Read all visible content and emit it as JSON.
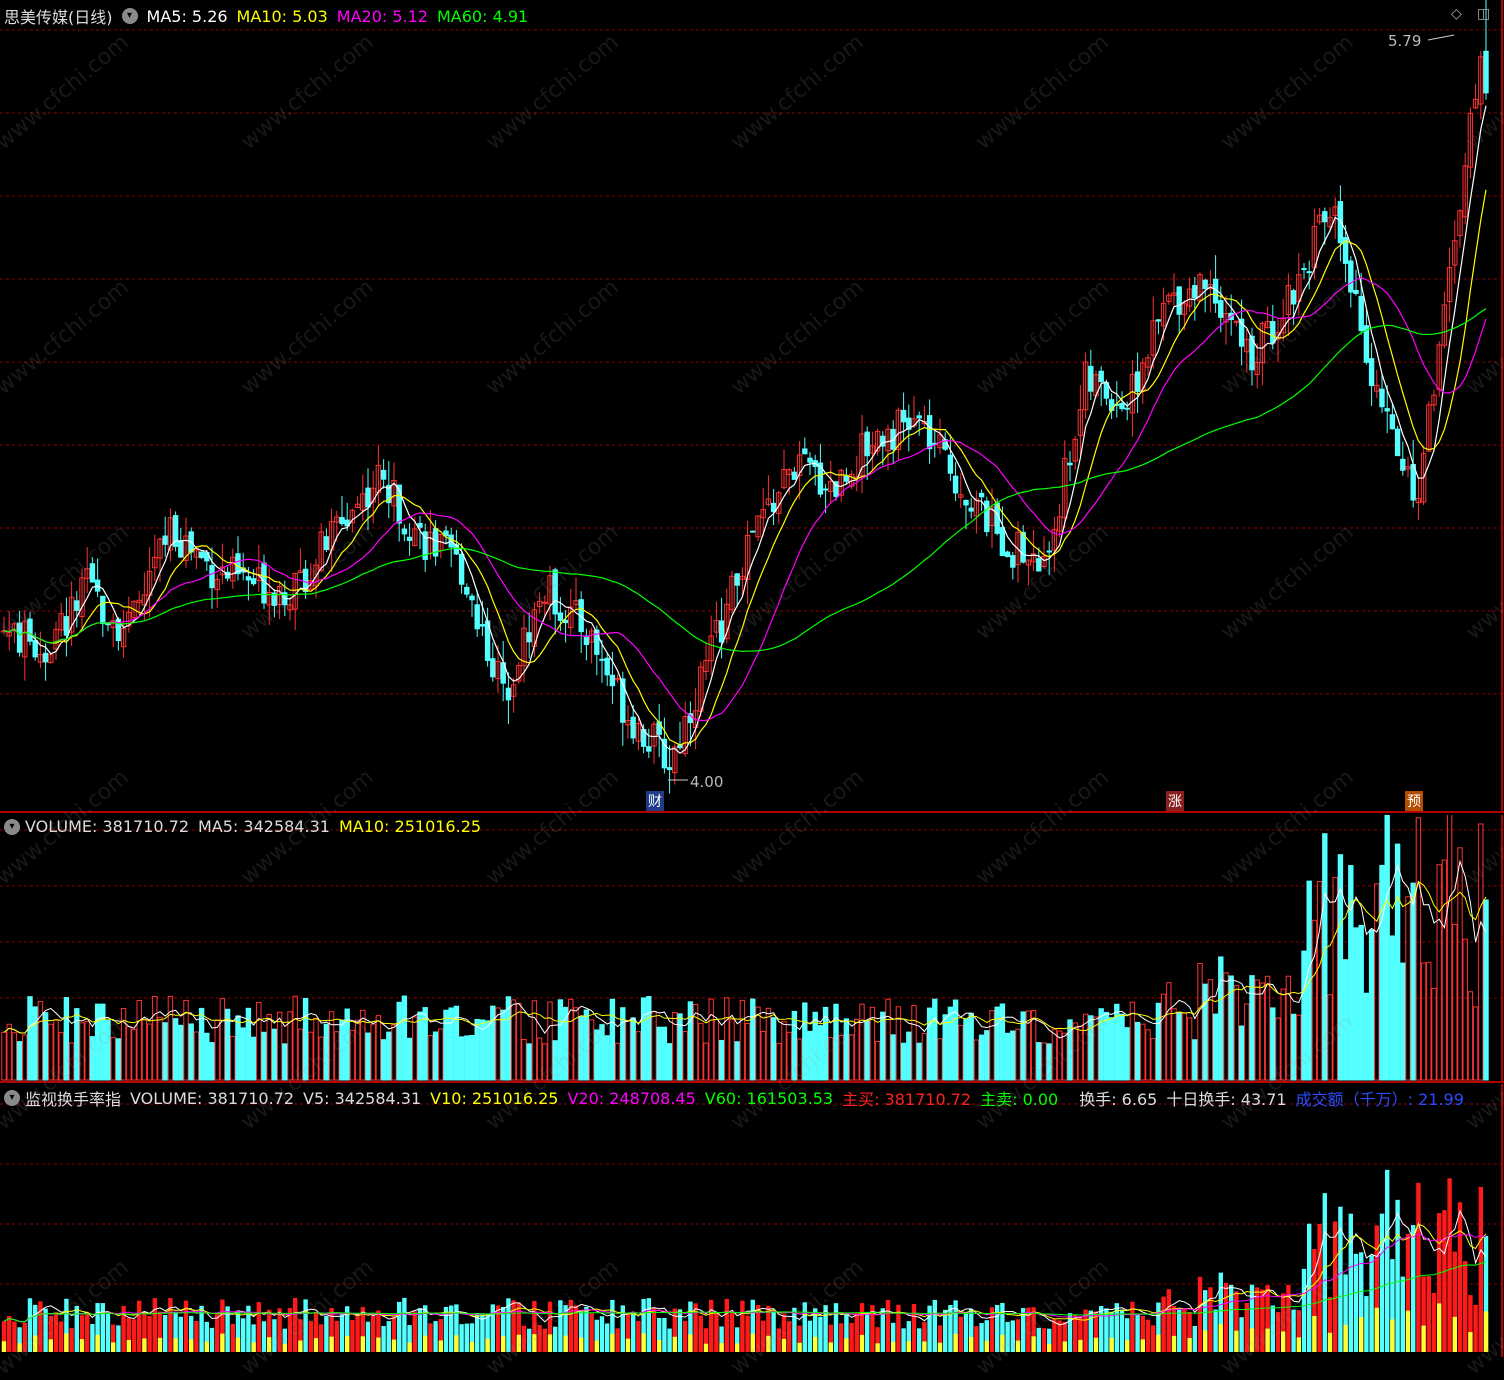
{
  "stock": {
    "name": "思美传媒",
    "period": "(日线)"
  },
  "price_header": {
    "ma5": "MA5: 5.26",
    "ma10": "MA10: 5.03",
    "ma20": "MA20: 5.12",
    "ma60": "MA60: 4.91"
  },
  "price_annotations": {
    "high": "5.79",
    "low": "4.00"
  },
  "markers": {
    "cai": "财",
    "zhang": "涨",
    "yu": "预"
  },
  "volume_header": {
    "volume": "VOLUME: 381710.72",
    "ma5": "MA5: 342584.31",
    "ma10": "MA10: 251016.25"
  },
  "turnover_header": {
    "title": "监视换手率指",
    "volume": "VOLUME: 381710.72",
    "v5": "V5: 342584.31",
    "v10": "V10: 251016.25",
    "v20": "V20: 248708.45",
    "v60": "V60: 161503.53",
    "buy": "主买: 381710.72",
    "sell": "主卖: 0.00",
    "turnover": "换手: 6.65",
    "turnover10": "十日换手: 43.71",
    "amount": "成交额（千万）: 21.99"
  },
  "watermark": "www.cfchi.com",
  "colors": {
    "up": "#ff3232",
    "down": "#54ffff",
    "ma5": "#ffffff",
    "ma10": "#ffff00",
    "ma20": "#ff00ff",
    "ma60": "#00ff00",
    "grid": "#8b0000"
  },
  "chart_data": [
    {
      "type": "candlestick",
      "title": "思美传媒(日线)",
      "ylim": [
        4.0,
        5.79
      ],
      "ma": {
        "MA5": 5.26,
        "MA10": 5.03,
        "MA20": 5.12,
        "MA60": 4.91
      },
      "annotations": [
        {
          "label": "5.79",
          "kind": "high"
        },
        {
          "label": "4.00",
          "kind": "low"
        }
      ]
    },
    {
      "type": "bar",
      "title": "VOLUME",
      "values_latest": {
        "VOLUME": 381710.72,
        "MA5": 342584.31,
        "MA10": 251016.25
      }
    },
    {
      "type": "bar",
      "title": "监视换手率指",
      "values_latest": {
        "VOLUME": 381710.72,
        "V5": 342584.31,
        "V10": 251016.25,
        "V20": 248708.45,
        "V60": 161503.53,
        "主买": 381710.72,
        "主卖": 0.0,
        "换手": 6.65,
        "十日换手": 43.71,
        "成交额（千万）": 21.99
      }
    }
  ]
}
